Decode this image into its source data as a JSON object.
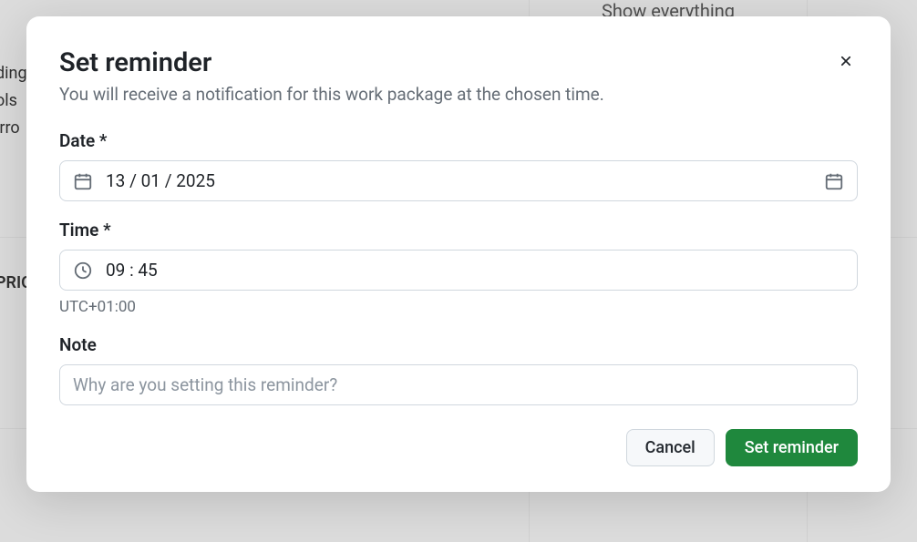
{
  "backdrop": {
    "show_everything": "Show everything",
    "t1": "ding",
    "t2": "ols",
    "t3": "irro",
    "prio": "PRIO"
  },
  "modal": {
    "title": "Set reminder",
    "subtitle": "You will receive a notification for this work package at the chosen time.",
    "date_label": "Date *",
    "date_value": "13 / 01 / 2025",
    "time_label": "Time *",
    "time_value": "09 : 45",
    "timezone": "UTC+01:00",
    "note_label": "Note",
    "note_placeholder": "Why are you setting this reminder?",
    "cancel_label": "Cancel",
    "submit_label": "Set reminder"
  }
}
